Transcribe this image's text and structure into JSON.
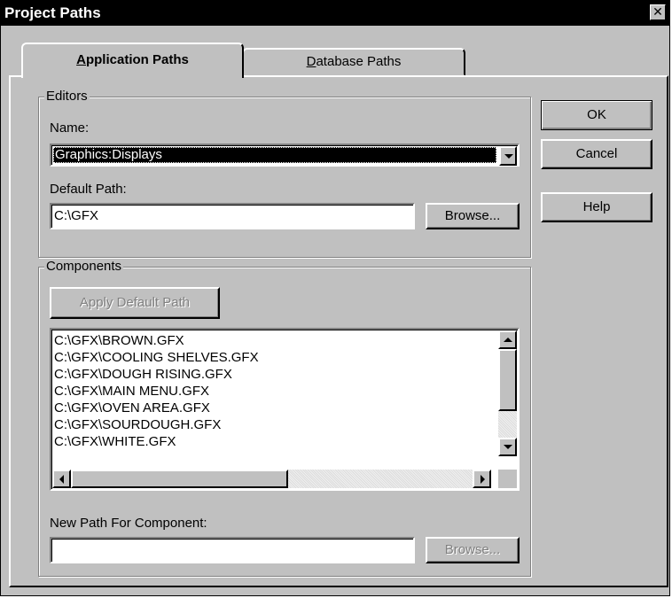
{
  "window": {
    "title": "Project Paths",
    "close_glyph": "✕"
  },
  "tabs": [
    {
      "label_mnemonic": "A",
      "label_rest": "pplication Paths",
      "active": true
    },
    {
      "label_mnemonic": "D",
      "label_rest": "atabase Paths",
      "active": false
    }
  ],
  "editors": {
    "group_label": "Editors",
    "name_label": "Name:",
    "name_value": "Graphics:Displays",
    "default_path_label": "Default Path:",
    "default_path_value": "C:\\GFX",
    "browse_label": "Browse..."
  },
  "components": {
    "group_label": "Components",
    "apply_default_label": "Apply Default Path",
    "items": [
      "C:\\GFX\\BROWN.GFX",
      "C:\\GFX\\COOLING SHELVES.GFX",
      "C:\\GFX\\DOUGH RISING.GFX",
      "C:\\GFX\\MAIN MENU.GFX",
      "C:\\GFX\\OVEN AREA.GFX",
      "C:\\GFX\\SOURDOUGH.GFX",
      "C:\\GFX\\WHITE.GFX"
    ],
    "new_path_label": "New Path For Component:",
    "new_path_value": "",
    "browse_label": "Browse..."
  },
  "buttons": {
    "ok": "OK",
    "cancel": "Cancel",
    "help": "Help"
  },
  "colors": {
    "dialog_face": "#c0c0c0",
    "selection": "#000000",
    "selection_text": "#ffffff",
    "disabled_text": "#808080"
  }
}
